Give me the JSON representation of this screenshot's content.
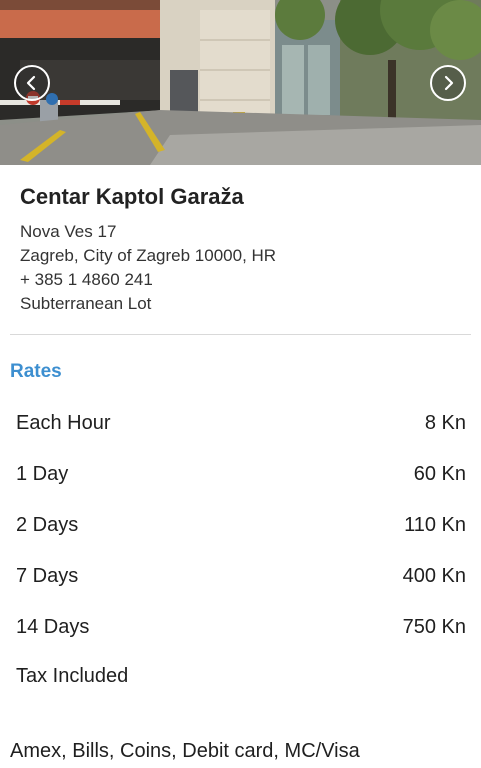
{
  "listing": {
    "name": "Centar Kaptol Garaža",
    "street": "Nova Ves 17",
    "city_line": "Zagreb, City of Zagreb 10000, HR",
    "phone": "+ 385 1 4860 241",
    "lot_type": "Subterranean Lot"
  },
  "rates": {
    "heading": "Rates",
    "items": [
      {
        "label": "Each Hour",
        "price": "8 Kn"
      },
      {
        "label": "1 Day",
        "price": "60 Kn"
      },
      {
        "label": "2 Days",
        "price": "110 Kn"
      },
      {
        "label": "7 Days",
        "price": "400 Kn"
      },
      {
        "label": "14 Days",
        "price": "750 Kn"
      }
    ],
    "tax_note": "Tax Included"
  },
  "payment_methods": "Amex, Bills, Coins, Debit card, MC/Visa",
  "photo": {
    "prev_icon": "chevron-left-icon",
    "next_icon": "chevron-right-icon"
  }
}
